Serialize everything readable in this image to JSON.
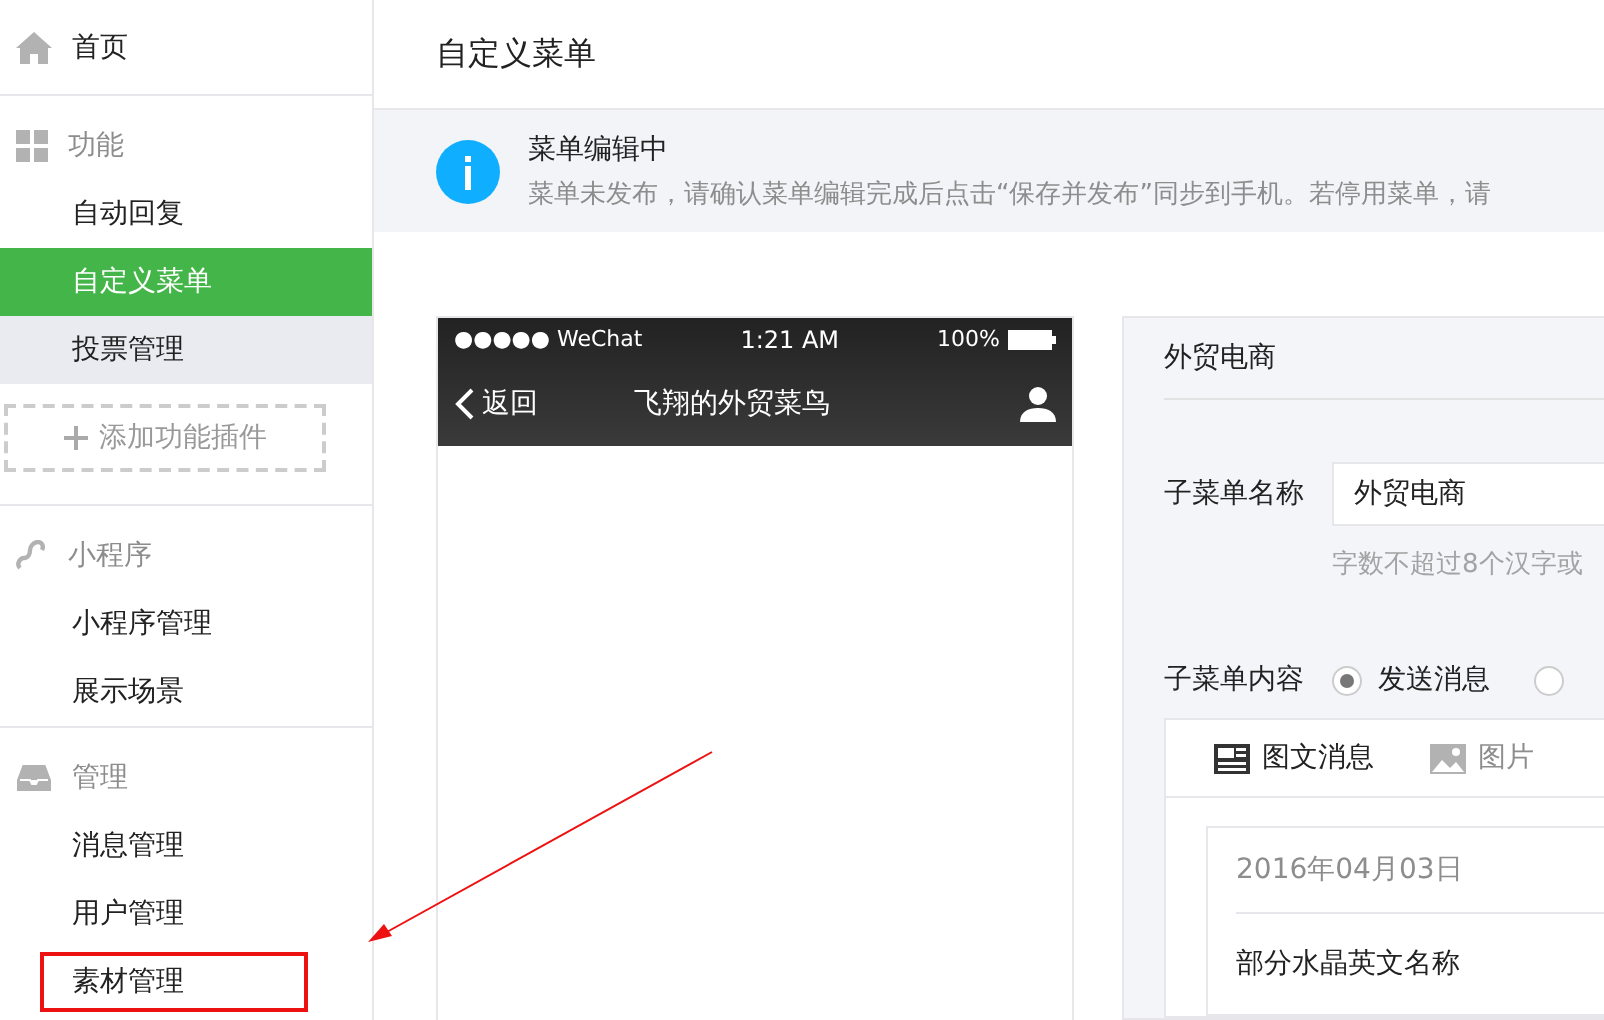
{
  "sidebar": {
    "sections": [
      {
        "kind": "link",
        "label": "首页"
      },
      {
        "kind": "group",
        "label": "功能",
        "items": [
          {
            "label": "自动回复",
            "selected": false,
            "hovered": false,
            "annotated": false
          },
          {
            "label": "自定义菜单",
            "selected": true,
            "hovered": false,
            "annotated": false
          },
          {
            "label": "投票管理",
            "selected": false,
            "hovered": true,
            "annotated": false
          }
        ],
        "add_button": "添加功能插件"
      },
      {
        "kind": "group",
        "label": "小程序",
        "items": [
          {
            "label": "小程序管理",
            "selected": false,
            "hovered": false,
            "annotated": false
          },
          {
            "label": "展示场景",
            "selected": false,
            "hovered": false,
            "annotated": false
          }
        ]
      },
      {
        "kind": "group",
        "label": "管理",
        "items": [
          {
            "label": "消息管理",
            "selected": false,
            "hovered": false,
            "annotated": false
          },
          {
            "label": "用户管理",
            "selected": false,
            "hovered": false,
            "annotated": false
          },
          {
            "label": "素材管理",
            "selected": false,
            "hovered": false,
            "annotated": true
          }
        ]
      }
    ]
  },
  "page_title": "自定义菜单",
  "notice": {
    "title": "菜单编辑中",
    "text": "菜单未发布，请确认菜单编辑完成后点击“保存并发布”同步到手机。若停用菜单，请"
  },
  "phone": {
    "status": {
      "carrier": "●●●●● WeChat",
      "time": "1:21 AM",
      "battery": "100%"
    },
    "nav": {
      "back": "返回",
      "title": "飞翔的外贸菜鸟"
    }
  },
  "editor": {
    "menu_name": "外贸电商",
    "name_field": {
      "label": "子菜单名称",
      "value": "外贸电商",
      "hint": "字数不超过8个汉字或"
    },
    "content": {
      "label": "子菜单内容",
      "options": [
        {
          "label": "发送消息",
          "selected": true
        },
        {
          "selected": false
        }
      ],
      "tabs": [
        {
          "label": "图文消息",
          "selected": true
        },
        {
          "label": "图片",
          "selected": false
        }
      ],
      "article": {
        "date": "2016年04月03日",
        "title": "部分水晶英文名称"
      }
    }
  }
}
